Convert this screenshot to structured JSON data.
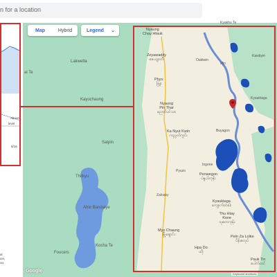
{
  "search": {
    "placeholder": "n for a location"
  },
  "map_controls": {
    "map_label": "Map",
    "hybrid_label": "Hybrid",
    "legend_label": "Legend"
  },
  "inset": {
    "label_1": "Above",
    "label_2": "level",
    "tick": "6/16"
  },
  "left_labels": {
    "l1": "ai Te"
  },
  "map_labels": {
    "lakwelta": "Lakwelta",
    "kayuchaung": "Kayuchaung",
    "satpin": "Satpin",
    "thitkyu": "Thitkyu",
    "ahle_bandaiye": "Ahle Bandaiye",
    "kocha_te": "Kocha Te",
    "foucers": "Foucers",
    "nyaung_chay_htauk": "Nyaung\nChay Htauk",
    "kya_khu_te": "Kyakhu Te",
    "zeyawaddy": "Zeyawaddy\nဇေယျဝတီ",
    "oaktwin": "Oaktwin",
    "kawbyin": "Kawbyin",
    "phyu": "Phyu\nဖြူး",
    "min": "Min",
    "nyaung_pin_thar": "Nyaung\nPin Thar\nညောင်ပင်သာ",
    "kyauktaga_n": "Kyauktaga",
    "ka_nyut_kwin": "Ka Nyut Kwin\nကညွတ်ကွင်း",
    "buyagon": "Buyagon",
    "ingone": "Ingone",
    "penwegon": "Penwegon\nပဲနွယ်ကုန်း",
    "pyuzo": "Pyuzo",
    "zaloaky": "Zaloaky",
    "kyauktaga": "Kyauktaga\nကျောက်တံခါး",
    "thu_htay_kone": "Thu Htay\nKone\nသုတေကုန်း",
    "myo_chaung": "Myo Chaung\nမြို့ချောင်း",
    "hpa_do": "Hpa Do\nဖဒို",
    "pein_za_lolke": "Pein Za Lolke\nပိန်းဇလုပ်",
    "pauk_tin": "Pauk Tin\nပေါက်တင်"
  },
  "footnote": {
    "line1": "al",
    "line2": "ion,",
    "line3": "on."
  },
  "google_logo": "Google",
  "attribution": "Keyboard shortcuts",
  "colors": {
    "land": "#f2eee0",
    "water_green": "#a9dcc0",
    "flood": "#1d4fb8",
    "river": "#6b8dd6",
    "frame": "#d32f2f",
    "road": "#f5c242"
  }
}
